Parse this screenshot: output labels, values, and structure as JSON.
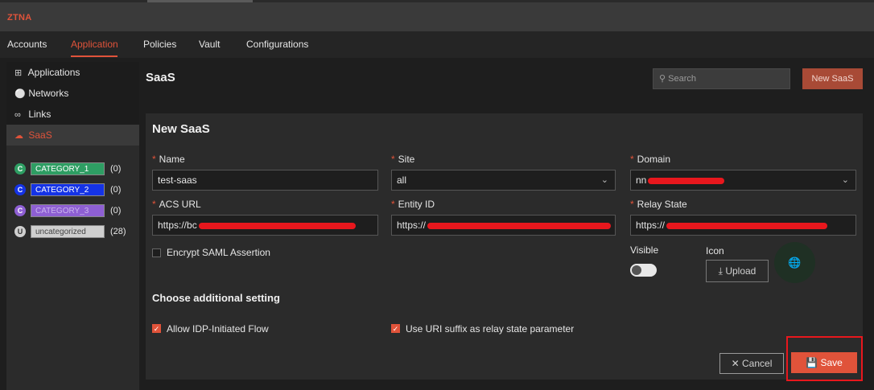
{
  "app": {
    "brand": "ZTNA"
  },
  "nav": {
    "items": [
      {
        "label": "Accounts"
      },
      {
        "label": "Application"
      },
      {
        "label": "Policies"
      },
      {
        "label": "Vault"
      },
      {
        "label": "Configurations"
      }
    ],
    "active": "Application"
  },
  "sidebar": {
    "items": [
      {
        "label": "Applications",
        "icon": "grid-icon"
      },
      {
        "label": "Networks",
        "icon": "globe-icon"
      },
      {
        "label": "Links",
        "icon": "link-icon"
      },
      {
        "label": "SaaS",
        "icon": "cloud-icon",
        "active": true
      }
    ],
    "categories": [
      {
        "badge": "C",
        "label": "CATEGORY_1",
        "count": "(0)",
        "color": "#2e9e63"
      },
      {
        "badge": "C",
        "label": "CATEGORY_2",
        "count": "(0)",
        "color": "#1533e6"
      },
      {
        "badge": "C",
        "label": "CATEGORY_3",
        "count": "(0)",
        "color": "#8e5fd3"
      },
      {
        "badge": "U",
        "label": "uncategorized",
        "count": "(28)",
        "color": "#cfcfcf"
      }
    ]
  },
  "header": {
    "title": "SaaS",
    "search_placeholder": "Search",
    "new_button": "New SaaS"
  },
  "form": {
    "title": "New SaaS",
    "fields": {
      "name": {
        "label": "Name",
        "value": "test-saas"
      },
      "site": {
        "label": "Site",
        "value": "all"
      },
      "domain": {
        "label": "Domain",
        "value": "nn"
      },
      "acs_url": {
        "label": "ACS URL",
        "value": "https://bc"
      },
      "entity_id": {
        "label": "Entity ID",
        "value": "https://"
      },
      "relay_state": {
        "label": "Relay State",
        "value": "https://"
      }
    },
    "encrypt_saml": {
      "label": "Encrypt SAML Assertion",
      "checked": false
    },
    "visible": {
      "label": "Visible",
      "on": false
    },
    "icon": {
      "label": "Icon",
      "upload": "Upload"
    },
    "additional_title": "Choose additional setting",
    "allow_idp": {
      "label": "Allow IDP-Initiated Flow",
      "checked": true
    },
    "uri_suffix": {
      "label": "Use URI suffix as relay state parameter",
      "checked": true
    },
    "cancel": "Cancel",
    "save": "Save"
  },
  "colors": {
    "accent": "#e0533a",
    "highlight": "#e8171d"
  }
}
